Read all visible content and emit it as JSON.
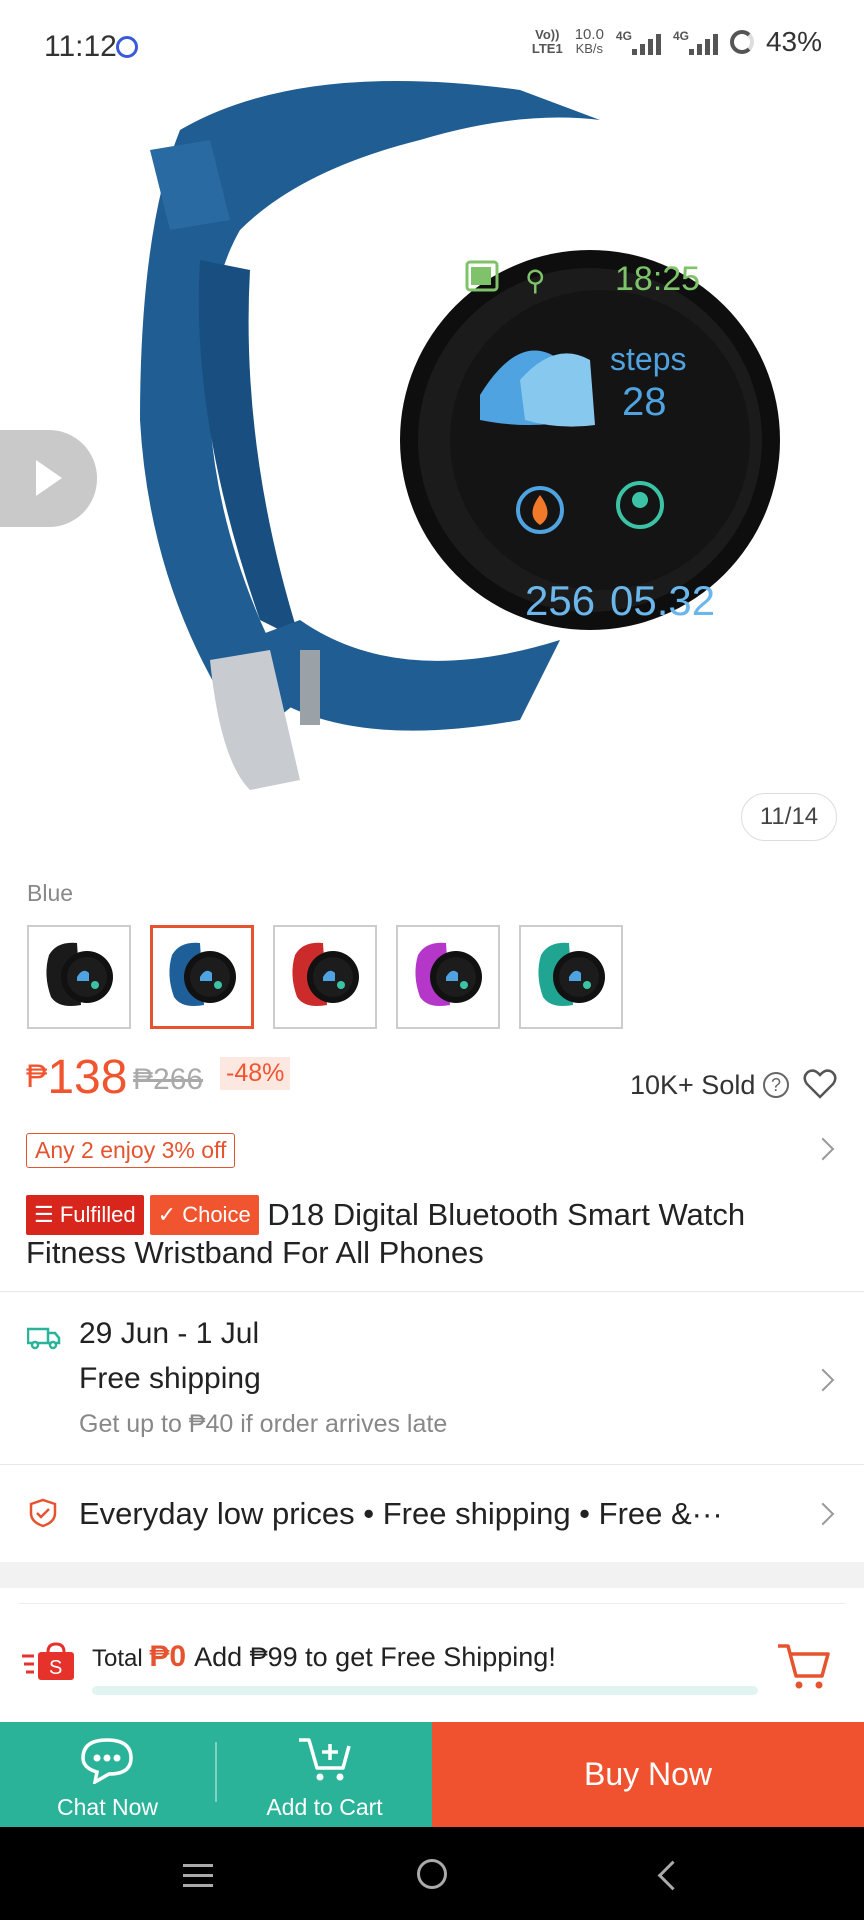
{
  "status_bar": {
    "time": "11:12",
    "volte_top": "Vo))",
    "volte_bottom": "LTE1",
    "speed_top": "10.0",
    "speed_bottom": "KB/s",
    "net1": "4G",
    "net2": "4G",
    "battery": "43%"
  },
  "gallery": {
    "counter": "11/14",
    "watch_time": "18:25",
    "watch_steps_label": "steps",
    "watch_steps": "28",
    "watch_val1": "256",
    "watch_val2": "05.32"
  },
  "variants": {
    "selected_label": "Blue",
    "colors": [
      "#1a1a1a",
      "#1f5f99",
      "#cc2b2b",
      "#b537c9",
      "#1fa592"
    ]
  },
  "price": {
    "currency": "₱",
    "current": "138",
    "original": "₱266",
    "discount": "-48%",
    "sold": "10K+ Sold"
  },
  "promo": {
    "label": "Any 2 enjoy 3% off"
  },
  "product": {
    "badge_fulfilled": "Fulfilled",
    "badge_choice": "Choice",
    "title": "D18 Digital Bluetooth Smart Watch Fitness Wristband For All Phones"
  },
  "shipping": {
    "date": "29 Jun - 1 Jul",
    "free": "Free shipping",
    "late": "Get up to ₱40 if order arrives late"
  },
  "guarantee": {
    "text": "Everyday low prices  •  Free shipping  •  Free &···"
  },
  "cart_bar": {
    "total_label": "Total",
    "total_value": "₱0",
    "message": "Add ₱99 to get Free Shipping!",
    "progress": 0
  },
  "actions": {
    "chat": "Chat Now",
    "add_to_cart": "Add to Cart",
    "buy_now": "Buy Now"
  },
  "colors": {
    "accent": "#f0552f",
    "teal": "#2bb39a"
  }
}
